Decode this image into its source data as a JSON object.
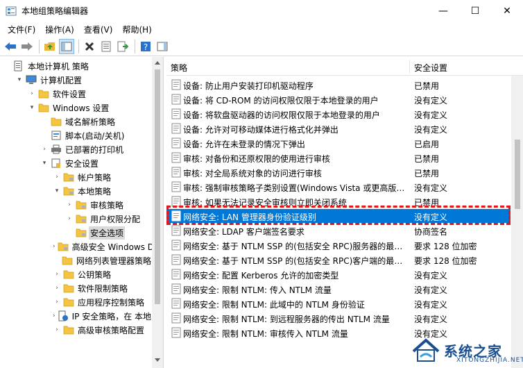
{
  "window": {
    "title": "本地组策略编辑器",
    "minimize_glyph": "—",
    "maximize_glyph": "☐",
    "close_glyph": "✕"
  },
  "menu": [
    "文件(F)",
    "操作(A)",
    "查看(V)",
    "帮助(H)"
  ],
  "toolbar": {
    "icons": [
      "back-arrow-icon",
      "forward-arrow-icon",
      "up-folder-icon",
      "show-hide-tree-icon",
      "delete-icon",
      "properties-icon",
      "export-list-icon",
      "help-icon",
      "show-pane-icon"
    ]
  },
  "tree": [
    {
      "label": "本地计算机 策略",
      "level": 0,
      "expander": "",
      "icon": "computer-policy"
    },
    {
      "label": "计算机配置",
      "level": 1,
      "expander": "▾",
      "icon": "computer"
    },
    {
      "label": "软件设置",
      "level": 2,
      "expander": "›",
      "icon": "folder"
    },
    {
      "label": "Windows 设置",
      "level": 2,
      "expander": "▾",
      "icon": "folder"
    },
    {
      "label": "域名解析策略",
      "level": 3,
      "expander": "",
      "icon": "folder"
    },
    {
      "label": "脚本(启动/关机)",
      "level": 3,
      "expander": "",
      "icon": "script"
    },
    {
      "label": "已部署的打印机",
      "level": 3,
      "expander": "›",
      "icon": "printer"
    },
    {
      "label": "安全设置",
      "level": 3,
      "expander": "▾",
      "icon": "security"
    },
    {
      "label": "帐户策略",
      "level": 4,
      "expander": "›",
      "icon": "folder-lock"
    },
    {
      "label": "本地策略",
      "level": 4,
      "expander": "▾",
      "icon": "folder-lock"
    },
    {
      "label": "审核策略",
      "level": 5,
      "expander": "›",
      "icon": "folder-lock"
    },
    {
      "label": "用户权限分配",
      "level": 5,
      "expander": "›",
      "icon": "folder-lock"
    },
    {
      "label": "安全选项",
      "level": 5,
      "expander": "",
      "icon": "folder-lock",
      "selected": true
    },
    {
      "label": "高级安全 Windows D",
      "level": 4,
      "expander": "›",
      "icon": "folder-lock"
    },
    {
      "label": "网络列表管理器策略",
      "level": 4,
      "expander": "",
      "icon": "folder"
    },
    {
      "label": "公钥策略",
      "level": 4,
      "expander": "›",
      "icon": "folder"
    },
    {
      "label": "软件限制策略",
      "level": 4,
      "expander": "›",
      "icon": "folder"
    },
    {
      "label": "应用程序控制策略",
      "level": 4,
      "expander": "›",
      "icon": "folder"
    },
    {
      "label": "IP 安全策略，在 本地",
      "level": 4,
      "expander": "›",
      "icon": "ipsec"
    },
    {
      "label": "高级审核策略配置",
      "level": 4,
      "expander": "›",
      "icon": "folder"
    }
  ],
  "list": {
    "col_policy": "策略",
    "col_setting": "安全设置",
    "rows": [
      {
        "name": "设备: 防止用户安装打印机驱动程序",
        "setting": "已禁用"
      },
      {
        "name": "设备: 将 CD-ROM 的访问权限仅限于本地登录的用户",
        "setting": "没有定义"
      },
      {
        "name": "设备: 将软盘驱动器的访问权限仅限于本地登录的用户",
        "setting": "没有定义"
      },
      {
        "name": "设备: 允许对可移动媒体进行格式化并弹出",
        "setting": "没有定义"
      },
      {
        "name": "设备: 允许在未登录的情况下弹出",
        "setting": "已启用"
      },
      {
        "name": "审核: 对备份和还原权限的使用进行审核",
        "setting": "已禁用"
      },
      {
        "name": "审核: 对全局系统对象的访问进行审核",
        "setting": "已禁用"
      },
      {
        "name": "审核: 强制审核策略子类别设置(Windows Vista 或更高版本…",
        "setting": "没有定义"
      },
      {
        "name": "审核: 如果无法记录安全审核则立即关闭系统",
        "setting": "已禁用"
      },
      {
        "name": "网络安全: LAN 管理器身份验证级别",
        "setting": "没有定义",
        "selected": true
      },
      {
        "name": "网络安全: LDAP 客户端签名要求",
        "setting": "协商签名"
      },
      {
        "name": "网络安全: 基于 NTLM SSP 的(包括安全 RPC)服务器的最小…",
        "setting": "要求 128 位加密"
      },
      {
        "name": "网络安全: 基于 NTLM SSP 的(包括安全 RPC)客户端的最小…",
        "setting": "要求 128 位加密"
      },
      {
        "name": "网络安全: 配置 Kerberos 允许的加密类型",
        "setting": "没有定义"
      },
      {
        "name": "网络安全: 限制 NTLM: 传入 NTLM 流量",
        "setting": "没有定义"
      },
      {
        "name": "网络安全: 限制 NTLM: 此域中的 NTLM 身份验证",
        "setting": "没有定义"
      },
      {
        "name": "网络安全: 限制 NTLM: 到远程服务器的传出 NTLM 流量",
        "setting": "没有定义"
      },
      {
        "name": "网络安全: 限制 NTLM: 审核传入 NTLM 流量",
        "setting": "没有定义"
      }
    ]
  },
  "watermark": {
    "text": "系统之家",
    "sub": "XITONGZHIJIA.NET"
  },
  "colors": {
    "selection": "#0078d7",
    "highlight_border": "#e0161b",
    "folder": "#f4c542"
  }
}
